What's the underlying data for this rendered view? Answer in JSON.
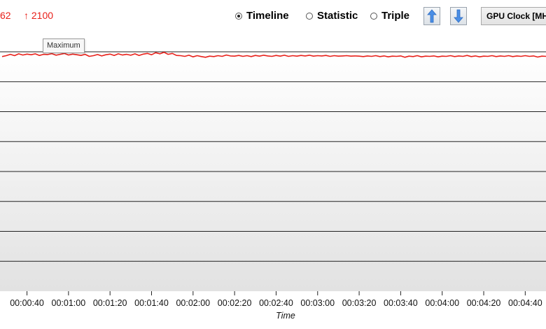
{
  "stats": {
    "min_label": "62",
    "max_label": "↑ 2100"
  },
  "view_modes": [
    {
      "label": "Timeline",
      "checked": true
    },
    {
      "label": "Statistic",
      "checked": false
    },
    {
      "label": "Triple",
      "checked": false
    }
  ],
  "sensor_selector": {
    "label": "GPU Clock [MHz]"
  },
  "tooltip": "Maximum",
  "colors": {
    "series": "#e8201a",
    "gridline": "#222222"
  },
  "icons": {
    "up": "arrow-up-icon",
    "down": "arrow-down-icon"
  },
  "chart_data": {
    "type": "line",
    "xlabel": "Time",
    "ylabel": "",
    "x_range_seconds": [
      27,
      290
    ],
    "x_tick_labels": [
      "00:00:40",
      "00:01:00",
      "00:01:20",
      "00:01:40",
      "00:02:00",
      "00:02:20",
      "00:02:40",
      "00:03:00",
      "00:03:20",
      "00:03:40",
      "00:04:00",
      "00:04:20",
      "00:04:40"
    ],
    "x_tick_seconds": [
      40,
      60,
      80,
      100,
      120,
      140,
      160,
      180,
      200,
      220,
      240,
      260,
      280
    ],
    "ylim": [
      0,
      2100
    ],
    "horizontal_grid": true,
    "series": [
      {
        "color": "#e8201a",
        "points": [
          [
            28,
            2058
          ],
          [
            30,
            2066
          ],
          [
            32,
            2078
          ],
          [
            34,
            2066
          ],
          [
            36,
            2082
          ],
          [
            38,
            2072
          ],
          [
            40,
            2080
          ],
          [
            42,
            2074
          ],
          [
            44,
            2082
          ],
          [
            46,
            2068
          ],
          [
            48,
            2078
          ],
          [
            50,
            2076
          ],
          [
            52,
            2084
          ],
          [
            54,
            2070
          ],
          [
            56,
            2078
          ],
          [
            58,
            2086
          ],
          [
            60,
            2072
          ],
          [
            62,
            2080
          ],
          [
            64,
            2074
          ],
          [
            66,
            2068
          ],
          [
            68,
            2078
          ],
          [
            70,
            2060
          ],
          [
            72,
            2066
          ],
          [
            74,
            2076
          ],
          [
            76,
            2064
          ],
          [
            78,
            2074
          ],
          [
            80,
            2080
          ],
          [
            82,
            2068
          ],
          [
            84,
            2082
          ],
          [
            86,
            2072
          ],
          [
            88,
            2078
          ],
          [
            90,
            2070
          ],
          [
            92,
            2082
          ],
          [
            94,
            2068
          ],
          [
            96,
            2080
          ],
          [
            98,
            2086
          ],
          [
            100,
            2074
          ],
          [
            102,
            2092
          ],
          [
            104,
            2082
          ],
          [
            106,
            2096
          ],
          [
            108,
            2078
          ],
          [
            110,
            2086
          ],
          [
            112,
            2068
          ],
          [
            114,
            2066
          ],
          [
            116,
            2060
          ],
          [
            118,
            2070
          ],
          [
            120,
            2056
          ],
          [
            122,
            2066
          ],
          [
            124,
            2058
          ],
          [
            126,
            2052
          ],
          [
            128,
            2062
          ],
          [
            130,
            2058
          ],
          [
            132,
            2066
          ],
          [
            134,
            2060
          ],
          [
            136,
            2072
          ],
          [
            138,
            2064
          ],
          [
            140,
            2062
          ],
          [
            142,
            2068
          ],
          [
            144,
            2060
          ],
          [
            146,
            2066
          ],
          [
            148,
            2058
          ],
          [
            150,
            2068
          ],
          [
            152,
            2062
          ],
          [
            154,
            2070
          ],
          [
            156,
            2064
          ],
          [
            158,
            2060
          ],
          [
            160,
            2068
          ],
          [
            162,
            2062
          ],
          [
            164,
            2070
          ],
          [
            166,
            2060
          ],
          [
            168,
            2066
          ],
          [
            170,
            2062
          ],
          [
            172,
            2068
          ],
          [
            174,
            2064
          ],
          [
            176,
            2070
          ],
          [
            178,
            2062
          ],
          [
            180,
            2066
          ],
          [
            182,
            2064
          ],
          [
            184,
            2068
          ],
          [
            186,
            2060
          ],
          [
            188,
            2066
          ],
          [
            190,
            2062
          ],
          [
            192,
            2064
          ],
          [
            194,
            2066
          ],
          [
            196,
            2062
          ],
          [
            198,
            2064
          ],
          [
            200,
            2062
          ],
          [
            202,
            2058
          ],
          [
            204,
            2064
          ],
          [
            206,
            2060
          ],
          [
            208,
            2066
          ],
          [
            210,
            2058
          ],
          [
            212,
            2064
          ],
          [
            214,
            2056
          ],
          [
            216,
            2062
          ],
          [
            218,
            2060
          ],
          [
            220,
            2064
          ],
          [
            222,
            2052
          ],
          [
            224,
            2062
          ],
          [
            226,
            2058
          ],
          [
            228,
            2066
          ],
          [
            230,
            2056
          ],
          [
            232,
            2062
          ],
          [
            234,
            2060
          ],
          [
            236,
            2064
          ],
          [
            238,
            2056
          ],
          [
            240,
            2062
          ],
          [
            242,
            2060
          ],
          [
            244,
            2066
          ],
          [
            246,
            2058
          ],
          [
            248,
            2064
          ],
          [
            250,
            2060
          ],
          [
            252,
            2068
          ],
          [
            254,
            2058
          ],
          [
            256,
            2064
          ],
          [
            258,
            2056
          ],
          [
            260,
            2062
          ],
          [
            262,
            2060
          ],
          [
            264,
            2066
          ],
          [
            266,
            2058
          ],
          [
            268,
            2064
          ],
          [
            270,
            2060
          ],
          [
            272,
            2066
          ],
          [
            274,
            2058
          ],
          [
            276,
            2064
          ],
          [
            278,
            2060
          ],
          [
            280,
            2066
          ],
          [
            282,
            2060
          ],
          [
            284,
            2064
          ],
          [
            286,
            2054
          ],
          [
            288,
            2062
          ],
          [
            290,
            2060
          ]
        ]
      }
    ]
  }
}
